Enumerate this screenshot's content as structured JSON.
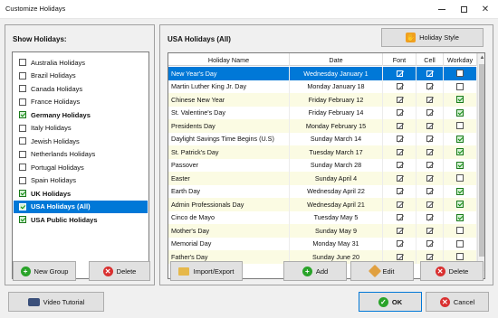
{
  "window": {
    "title": "Customize Holidays"
  },
  "left": {
    "heading": "Show Holidays:",
    "items": [
      {
        "label": "Australia Holidays",
        "checked": false,
        "bold": false,
        "selected": false
      },
      {
        "label": "Brazil Holidays",
        "checked": false,
        "bold": false,
        "selected": false
      },
      {
        "label": "Canada Holidays",
        "checked": false,
        "bold": false,
        "selected": false
      },
      {
        "label": "France Holidays",
        "checked": false,
        "bold": false,
        "selected": false
      },
      {
        "label": "Germany Holidays",
        "checked": true,
        "bold": true,
        "selected": false
      },
      {
        "label": "Italy Holidays",
        "checked": false,
        "bold": false,
        "selected": false
      },
      {
        "label": "Jewish Holidays",
        "checked": false,
        "bold": false,
        "selected": false
      },
      {
        "label": "Netherlands Holidays",
        "checked": false,
        "bold": false,
        "selected": false
      },
      {
        "label": "Portugal Holidays",
        "checked": false,
        "bold": false,
        "selected": false
      },
      {
        "label": "Spain Holidays",
        "checked": false,
        "bold": false,
        "selected": false
      },
      {
        "label": "UK Holidays",
        "checked": true,
        "bold": true,
        "selected": false
      },
      {
        "label": "USA Holidays (All)",
        "checked": true,
        "bold": true,
        "selected": true
      },
      {
        "label": "USA Public Holidays",
        "checked": true,
        "bold": true,
        "selected": false
      }
    ],
    "new_group_label": "New Group",
    "delete_label": "Delete"
  },
  "right": {
    "heading": "USA Holidays (All)",
    "holiday_style_label": "Holiday Style",
    "columns": [
      "Holiday Name",
      "Date",
      "Font",
      "Cell",
      "Workday"
    ],
    "rows": [
      {
        "name": "New Year's Day",
        "date": "Wednesday January 1",
        "workday": false
      },
      {
        "name": "Martin Luther King Jr. Day",
        "date": "Monday January 18",
        "workday": false
      },
      {
        "name": "Chinese New Year",
        "date": "Friday February 12",
        "workday": true
      },
      {
        "name": "St. Valentine's Day",
        "date": "Friday February 14",
        "workday": true
      },
      {
        "name": "Presidents Day",
        "date": "Monday February 15",
        "workday": false
      },
      {
        "name": "Daylight Savings Time Begins (U.S)",
        "date": "Sunday March 14",
        "workday": true
      },
      {
        "name": "St. Patrick's Day",
        "date": "Tuesday March 17",
        "workday": true
      },
      {
        "name": "Passover",
        "date": "Sunday March 28",
        "workday": true
      },
      {
        "name": "Easter",
        "date": "Sunday April 4",
        "workday": false
      },
      {
        "name": "Earth Day",
        "date": "Wednesday April 22",
        "workday": true
      },
      {
        "name": "Admin Professionals Day",
        "date": "Wednesday April 21",
        "workday": true
      },
      {
        "name": "Cinco de Mayo",
        "date": "Tuesday May 5",
        "workday": true
      },
      {
        "name": "Mother's Day",
        "date": "Sunday May 9",
        "workday": false
      },
      {
        "name": "Memorial Day",
        "date": "Monday May 31",
        "workday": false
      },
      {
        "name": "Father's Day",
        "date": "Sunday June 20",
        "workday": false
      }
    ],
    "import_export_label": "Import/Export",
    "add_label": "Add",
    "edit_label": "Edit",
    "delete_label": "Delete"
  },
  "footer": {
    "video_tutorial_label": "Video Tutorial",
    "ok_label": "OK",
    "cancel_label": "Cancel"
  },
  "colors": {
    "selection": "#0078d7",
    "row_alt": "#fbfbe3",
    "check_green": "#0a8a0a"
  }
}
